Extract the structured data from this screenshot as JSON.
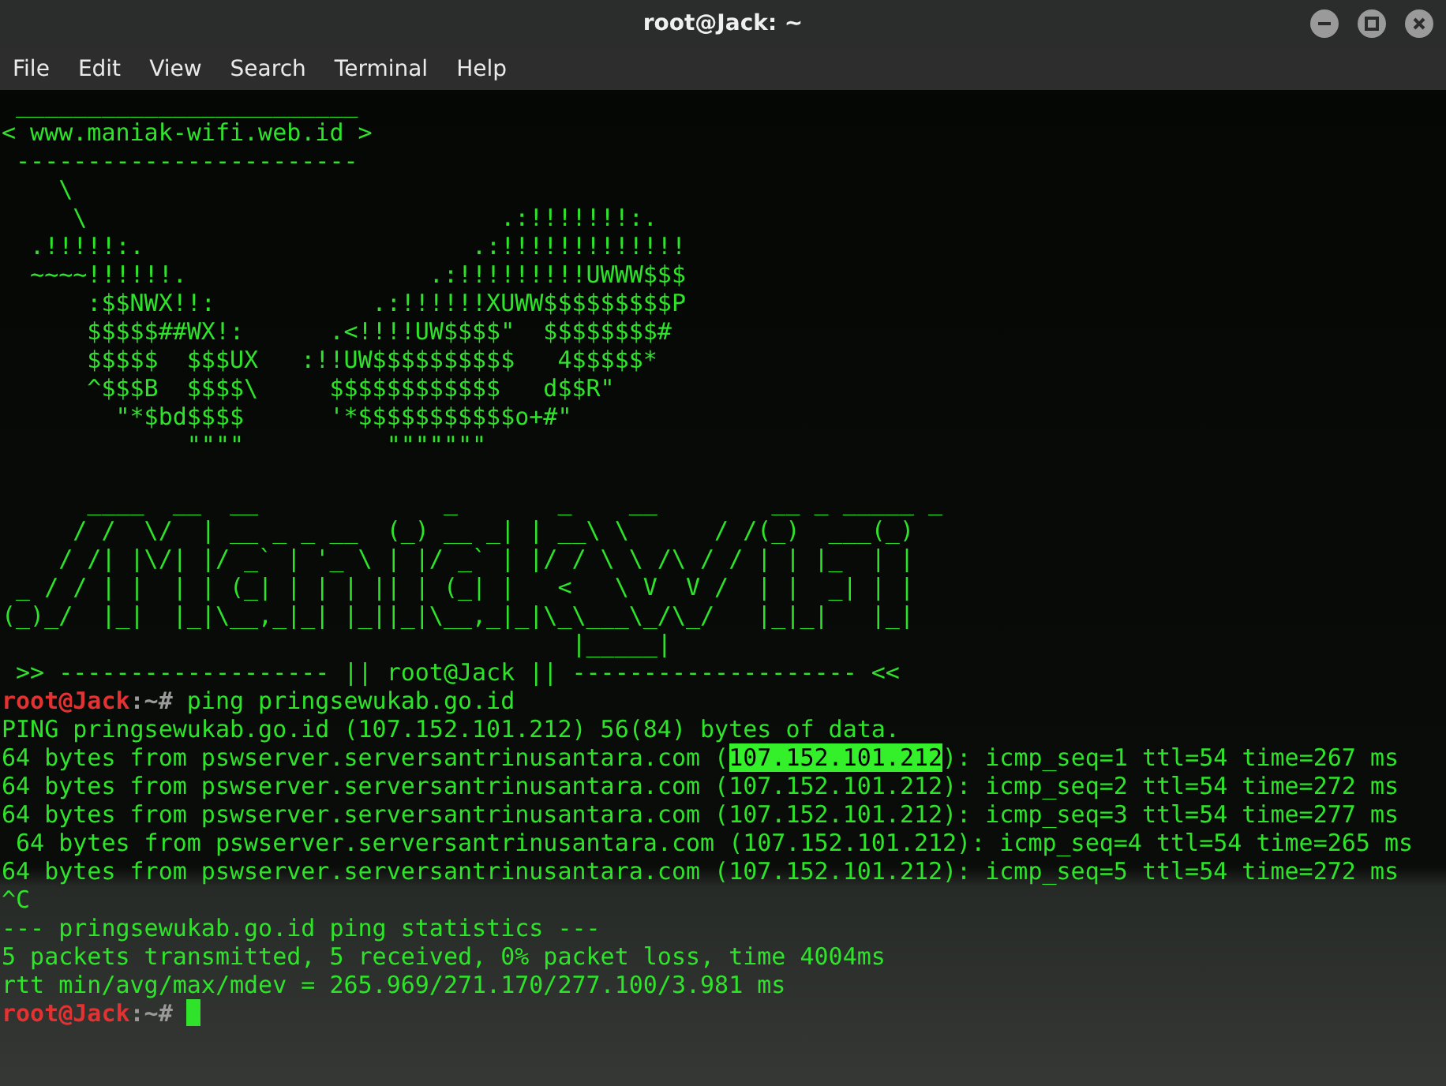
{
  "window": {
    "title": "root@Jack: ~"
  },
  "menu": [
    {
      "label": "File"
    },
    {
      "label": "Edit"
    },
    {
      "label": "View"
    },
    {
      "label": "Search"
    },
    {
      "label": "Terminal"
    },
    {
      "label": "Help"
    }
  ],
  "terminal": {
    "lines": [
      {
        "kind": "art",
        "text": " ________________________"
      },
      {
        "kind": "art",
        "text": "< www.maniak-wifi.web.id >"
      },
      {
        "kind": "art",
        "text": " ------------------------"
      },
      {
        "kind": "art",
        "text": "    \\"
      },
      {
        "kind": "art",
        "text": "     \\                             .:!!!!!!!:."
      },
      {
        "kind": "art",
        "text": "  .!!!!!:.                       .:!!!!!!!!!!!!!"
      },
      {
        "kind": "art",
        "text": "  ~~~~!!!!!!.                 .:!!!!!!!!!UWWW$$$"
      },
      {
        "kind": "art",
        "text": "      :$$NWX!!:           .:!!!!!!XUWW$$$$$$$$$P"
      },
      {
        "kind": "art",
        "text": "      $$$$$##WX!:      .<!!!!UW$$$$\"  $$$$$$$$#"
      },
      {
        "kind": "art",
        "text": "      $$$$$  $$$UX   :!!UW$$$$$$$$$$   4$$$$$*"
      },
      {
        "kind": "art",
        "text": "      ^$$$B  $$$$\\     $$$$$$$$$$$$   d$$R\""
      },
      {
        "kind": "art",
        "text": "        \"*$bd$$$$      '*$$$$$$$$$$$o+#\""
      },
      {
        "kind": "art",
        "text": "             \"\"\"\"          \"\"\"\"\"\"\""
      },
      {
        "kind": "blank"
      },
      {
        "kind": "art",
        "text": "      ____  __  __             _       _    __        __ _ _____ _"
      },
      {
        "kind": "art",
        "text": "     / /  \\/  | __ _ _ __  (_) __ _| | __\\ \\      / /(_)  ___(_)"
      },
      {
        "kind": "art",
        "text": "    / /| |\\/| |/ _` | '_ \\ | |/ _` | |/ / \\ \\ /\\ / / | | |_  | |"
      },
      {
        "kind": "art",
        "text": " _ / / | |  | | (_| | | | || | (_| |   <   \\ V  V /  | |  _| | |"
      },
      {
        "kind": "art",
        "text": "(_)_/  |_|  |_|\\__,_|_| |_||_|\\__,_|_|\\_\\___\\_/\\_/   |_|_|   |_|"
      },
      {
        "kind": "art",
        "text": "                                        |_____|"
      },
      {
        "kind": "art",
        "text": " >> ------------------- || root@Jack || -------------------- <<"
      },
      {
        "kind": "prompt",
        "user": "root@Jack",
        "path": ":~#",
        "command": "ping pringsewukab.go.id"
      },
      {
        "kind": "output",
        "text": "PING pringsewukab.go.id (107.152.101.212) 56(84) bytes of data."
      },
      {
        "kind": "selection",
        "before": "64 bytes from pswserver.serversantrinusantara.com (",
        "selected": "107.152.101.212",
        "after": "): icmp_seq=1 ttl=54 time=267 ms"
      },
      {
        "kind": "output",
        "text": "64 bytes from pswserver.serversantrinusantara.com (107.152.101.212): icmp_seq=2 ttl=54 time=272 ms"
      },
      {
        "kind": "output",
        "text": "64 bytes from pswserver.serversantrinusantara.com (107.152.101.212): icmp_seq=3 ttl=54 time=277 ms"
      },
      {
        "kind": "output",
        "text": " 64 bytes from pswserver.serversantrinusantara.com (107.152.101.212): icmp_seq=4 ttl=54 time=265 ms"
      },
      {
        "kind": "output",
        "text": "64 bytes from pswserver.serversantrinusantara.com (107.152.101.212): icmp_seq=5 ttl=54 time=272 ms"
      },
      {
        "kind": "output",
        "text": "^C"
      },
      {
        "kind": "output",
        "text": "--- pringsewukab.go.id ping statistics ---"
      },
      {
        "kind": "output",
        "text": "5 packets transmitted, 5 received, 0% packet loss, time 4004ms"
      },
      {
        "kind": "output",
        "text": "rtt min/avg/max/mdev = 265.969/271.170/277.100/3.981 ms"
      },
      {
        "kind": "prompt",
        "user": "root@Jack",
        "path": ":~#",
        "cursor": true
      }
    ]
  }
}
